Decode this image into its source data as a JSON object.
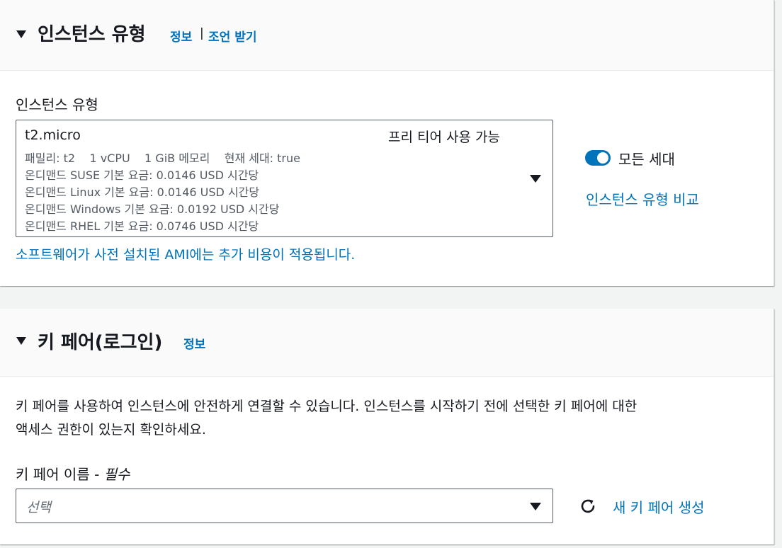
{
  "instance_type_section": {
    "title": "인스턴스 유형",
    "info_link": "정보",
    "separator": "|",
    "advice_link": "조언 받기",
    "field_label": "인스턴스 유형",
    "selected": {
      "name": "t2.micro",
      "free_tier": "프리 티어 사용 가능",
      "details": [
        "패밀리: t2    1 vCPU    1 GiB 메모리    현재 세대: true",
        "온디맨드 SUSE 기본 요금: 0.0146 USD 시간당",
        "온디맨드 Linux 기본 요금: 0.0146 USD 시간당",
        "온디맨드 Windows 기본 요금: 0.0192 USD 시간당",
        "온디맨드 RHEL 기본 요금: 0.0746 USD 시간당"
      ]
    },
    "all_generations_toggle": {
      "label": "모든 세대",
      "on": true
    },
    "compare_link": "인스턴스 유형 비교",
    "ami_note": "소프트웨어가 사전 설치된 AMI에는 추가 비용이 적용됩니다."
  },
  "key_pair_section": {
    "title": "키 페어(로그인)",
    "info_link": "정보",
    "description_line1": "키 페어를 사용하여 인스턴스에 안전하게 연결할 수 있습니다. 인스턴스를 시작하기 전에 선택한 키 페어에 대한",
    "description_line2": "액세스 권한이 있는지 확인하세요.",
    "field_label": "키 페어 이름 - ",
    "required_label": "필수",
    "select_placeholder": "선택",
    "create_link": "새 키 페어 생성",
    "refresh_icon": "refresh-icon"
  },
  "colors": {
    "link": "#0073bb",
    "toggle_on": "#0073bb",
    "text": "#16191f",
    "secondary_text": "#545b64"
  }
}
